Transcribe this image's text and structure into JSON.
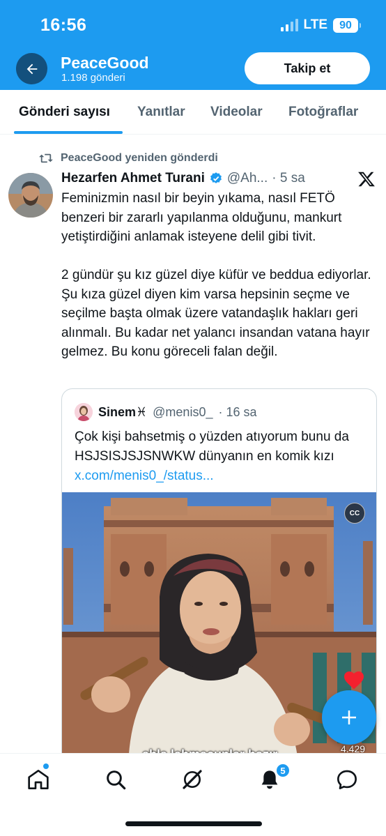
{
  "status_bar": {
    "time": "16:56",
    "network": "LTE",
    "battery": "90"
  },
  "header": {
    "profile_name": "PeaceGood",
    "post_count": "1.198 gönderi",
    "follow_label": "Takip et"
  },
  "tabs": [
    {
      "label": "Gönderi sayısı",
      "active": true
    },
    {
      "label": "Yanıtlar",
      "active": false
    },
    {
      "label": "Videolar",
      "active": false
    },
    {
      "label": "Fotoğraflar",
      "active": false
    }
  ],
  "tweet": {
    "repost_label": "PeaceGood yeniden gönderdi",
    "author_name": "Hezarfen Ahmet Turani",
    "author_handle": "@Ah...",
    "time": "· 5 sa",
    "text": "Feminizmin nasıl bir beyin yıkama, nasıl FETÖ benzeri bir zararlı yapılanma olduğunu, mankurt yetiştirdiğini anlamak isteyene delil gibi tivit.\n\n2 gündür şu kız güzel diye küfür ve beddua ediyorlar. Şu kıza güzel diyen kim varsa hepsinin seçme ve seçilme başta olmak üzere vatandaşlık hakları geri alınmalı. Bu kadar net yalancı insandan vatana hayır gelmez. Bu konu göreceli falan değil.",
    "quote": {
      "author_name": "Sinem♓",
      "author_handle": "@menis0_",
      "time": "· 16 sa",
      "text": "Çok kişi bahsetmiş o yüzden atıyorum bunu da HSJSISJSJSNWKW dünyanın en komik kızı",
      "link": "x.com/menis0_/status...",
      "media": {
        "cc_label": "CC",
        "caption": "abla lahmacunlar hazır",
        "views": "4.429"
      }
    }
  },
  "bottom_nav": {
    "items": [
      "home-icon",
      "search-icon",
      "grok-icon",
      "notifications-icon",
      "messages-icon"
    ],
    "notification_count": "5"
  },
  "colors": {
    "accent": "#1d9bf0",
    "text": "#0f1419",
    "muted": "#536471"
  }
}
